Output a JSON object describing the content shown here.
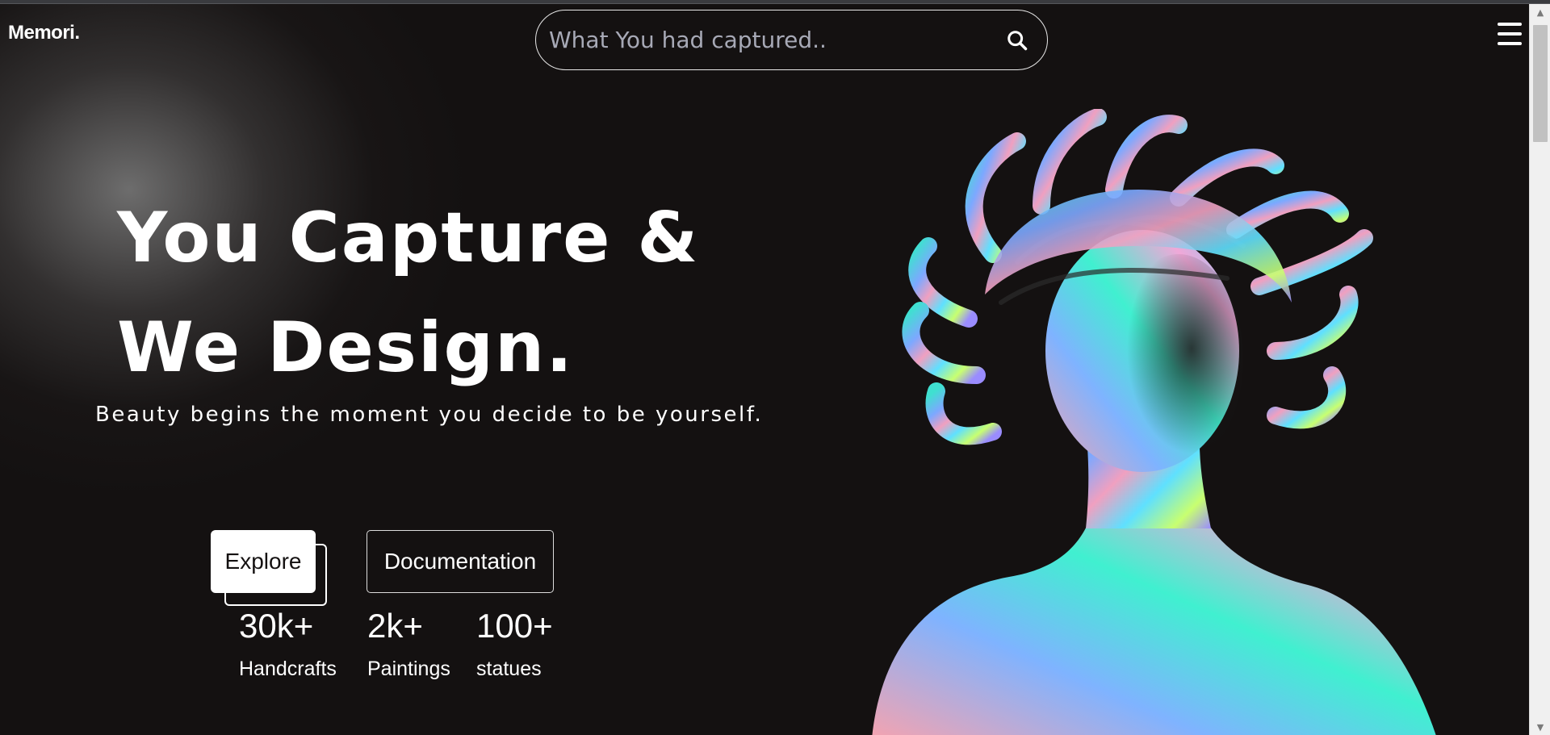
{
  "brand": {
    "logo": "Memori."
  },
  "search": {
    "placeholder": "What You had captured.."
  },
  "icons": {
    "search": "search-icon",
    "menu": "hamburger-menu-icon"
  },
  "hero": {
    "title_line1": "You Capture &",
    "title_line2": "We Design.",
    "subtitle": "Beauty begins the moment you decide to be yourself."
  },
  "buttons": {
    "explore": "Explore",
    "documentation": "Documentation"
  },
  "stats": [
    {
      "value": "30k+",
      "label": "Handcrafts"
    },
    {
      "value": "2k+",
      "label": "Paintings"
    },
    {
      "value": "100+",
      "label": "statues"
    }
  ],
  "colors": {
    "background": "#141111",
    "text": "#ffffff",
    "placeholder": "#a7a9b6"
  }
}
